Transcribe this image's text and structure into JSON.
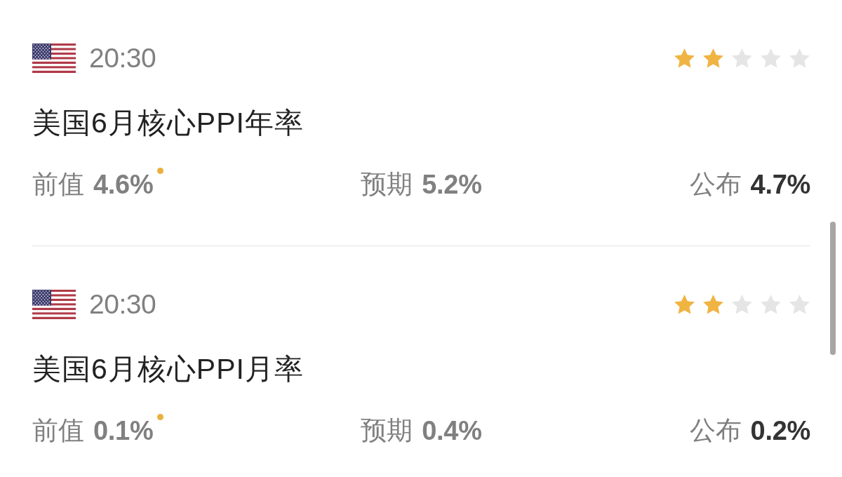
{
  "events": [
    {
      "time": "20:30",
      "stars": 2,
      "title": "美国6月核心PPI年率",
      "previous": {
        "label": "前值",
        "value": "4.6%",
        "revised": true
      },
      "forecast": {
        "label": "预期",
        "value": "5.2%"
      },
      "actual": {
        "label": "公布",
        "value": "4.7%"
      }
    },
    {
      "time": "20:30",
      "stars": 2,
      "title": "美国6月核心PPI月率",
      "previous": {
        "label": "前值",
        "value": "0.1%",
        "revised": true
      },
      "forecast": {
        "label": "预期",
        "value": "0.4%"
      },
      "actual": {
        "label": "公布",
        "value": "0.2%"
      }
    }
  ]
}
